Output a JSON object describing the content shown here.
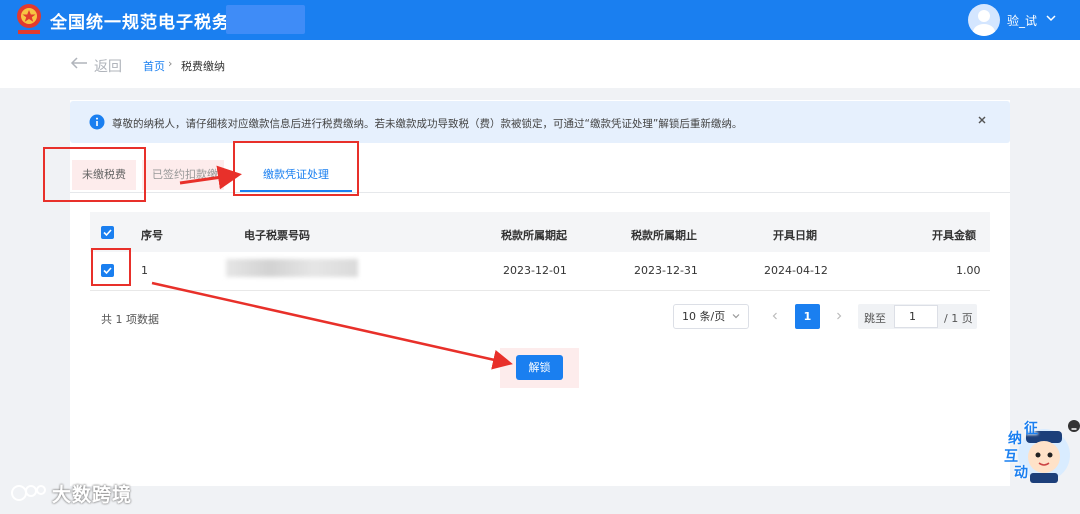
{
  "header": {
    "site_title": "全国统一规范电子税务局",
    "user_name": "验_试",
    "icons": [
      "tax-emblem-icon",
      "user-avatar-icon",
      "chevron-down-icon"
    ]
  },
  "breadcrumb": {
    "back_label": "返回",
    "home": "首页",
    "separator": "›",
    "current": "税费缴纳"
  },
  "notice": {
    "text": "尊敬的纳税人，请仔细核对应缴款信息后进行税费缴纳。若未缴款成功导致税（费）款被锁定，可通过“缴款凭证处理”解锁后重新缴纳。"
  },
  "tabs": [
    {
      "label": "未缴税费"
    },
    {
      "label": "已签约扣款缴"
    },
    {
      "label": "缴款凭证处理",
      "active": true
    }
  ],
  "table": {
    "columns": [
      "序号",
      "电子税票号码",
      "税款所属期起",
      "税款所属期止",
      "开具日期",
      "开具金额"
    ],
    "rows": [
      {
        "index": "1",
        "ticket_no": "",
        "period_start": "2023-12-01",
        "period_end": "2023-12-31",
        "issue_date": "2024-04-12",
        "amount": "1.00",
        "checked": true
      }
    ]
  },
  "pagination": {
    "total_text": "共 1 项数据",
    "page_size": "10 条/页",
    "current_page": "1",
    "jump_label": "跳至",
    "jump_value": "1",
    "total_pages": "/ 1 页"
  },
  "actions": {
    "unlock_label": "解锁"
  },
  "decor": {
    "watermark": "大数跨境",
    "mascot_chars": [
      "征",
      "纳",
      "互",
      "动"
    ]
  },
  "colors": {
    "primary": "#1a7ff0",
    "annotation": "#e8302a",
    "notice_bg": "#e6f0fd"
  }
}
